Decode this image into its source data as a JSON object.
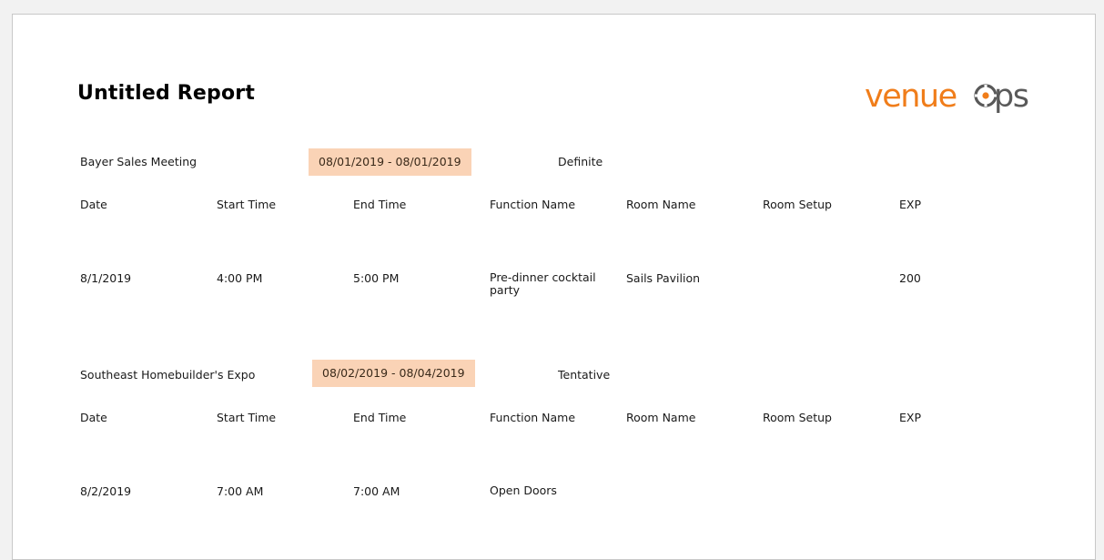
{
  "report": {
    "title": "Untitled Report"
  },
  "logo": {
    "part1": "venue",
    "part2": "ps",
    "accent_color": "#f07d1a",
    "gray_color": "#595959"
  },
  "date_highlight_color": "#fad3b6",
  "columns": {
    "date": "Date",
    "start_time": "Start Time",
    "end_time": "End Time",
    "function_name": "Function Name",
    "room_name": "Room Name",
    "room_setup": "Room Setup",
    "exp": "EXP"
  },
  "events": [
    {
      "name": "Bayer Sales Meeting",
      "date_range": "08/01/2019 - 08/01/2019",
      "status": "Definite",
      "rows": [
        {
          "date": "8/1/2019",
          "start_time": "4:00 PM",
          "end_time": "5:00 PM",
          "function_name": "Pre-dinner cocktail party",
          "room_name": "Sails Pavilion",
          "room_setup": "",
          "exp": "200"
        }
      ]
    },
    {
      "name": "Southeast Homebuilder's Expo",
      "date_range": "08/02/2019 - 08/04/2019",
      "status": "Tentative",
      "rows": [
        {
          "date": "8/2/2019",
          "start_time": "7:00 AM",
          "end_time": "7:00 AM",
          "function_name": "Open Doors",
          "room_name": "",
          "room_setup": "",
          "exp": ""
        }
      ]
    }
  ]
}
